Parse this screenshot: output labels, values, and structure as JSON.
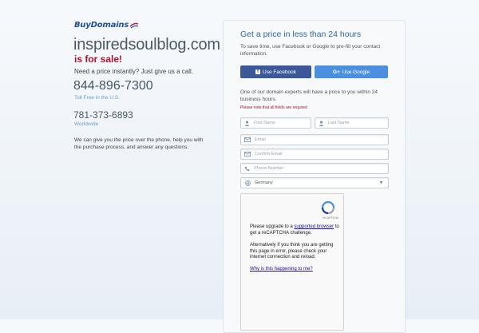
{
  "brand": {
    "logo_text": "BuyDomains"
  },
  "left": {
    "domain": "inspiredsoulblog.com",
    "for_sale": "is for sale!",
    "need_price": "Need a price instantly? Just give us a call.",
    "phone_primary": "844-896-7300",
    "toll_free_label": "Toll Free in the U.S.",
    "phone_secondary": "781-373-6893",
    "worldwide_label": "Worldwide",
    "pitch": "We can give you the price over the phone, help you with the purchase process, and answer any questions."
  },
  "form": {
    "title": "Get a price in less than 24 hours",
    "subtitle": "To save time, use Facebook or Google to pre-fill your contact information.",
    "facebook_label": "Use Facebook",
    "google_label": "Use Google",
    "google_prefix": "G+",
    "expert_text": "One of our domain experts will have a price to you within 24 business hours.",
    "required_note": "Please note that all fields are required",
    "first_name_placeholder": "First Name",
    "last_name_placeholder": "Last Name",
    "email_placeholder": "Email",
    "confirm_email_placeholder": "Confirm Email",
    "phone_placeholder": "Phone Number",
    "country_value": "Germany"
  },
  "captcha": {
    "brand": "reCAPTCHA",
    "msg_prefix": "Please upgrade to a ",
    "msg_link": "supported browser",
    "msg_suffix": " to get a reCAPTCHA challenge.",
    "alt_text": "Alternatively if you think you are getting this page in error, please check your internet connection and reload.",
    "why_link": "Why is this happening to me?"
  },
  "colors": {
    "brand_blue": "#1f4e9c",
    "sale_red": "#b0142e",
    "facebook": "#3b5998",
    "google": "#4b8fdf",
    "title_blue": "#2f6aa5"
  },
  "icons": {
    "person": "person-icon",
    "email": "envelope-icon",
    "phone": "phone-icon",
    "country": "globe-icon"
  }
}
